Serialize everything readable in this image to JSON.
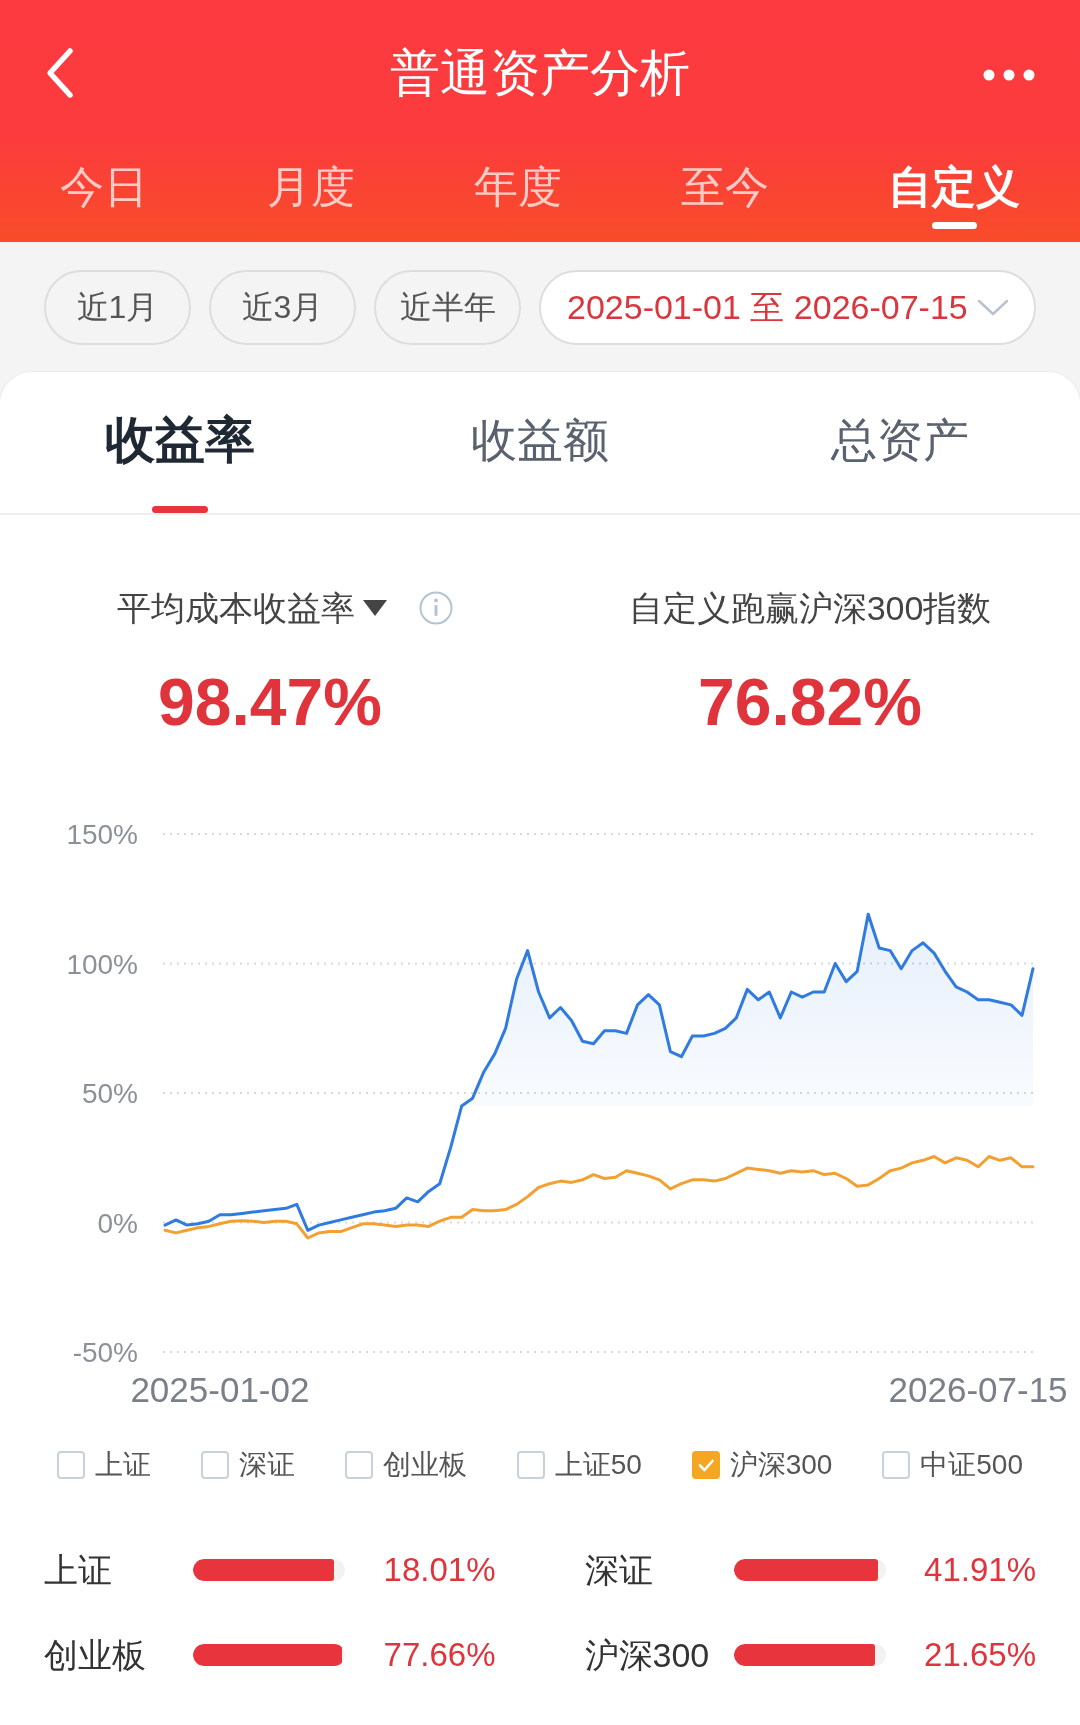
{
  "header": {
    "title": "普通资产分析"
  },
  "period_tabs": [
    {
      "label": "今日",
      "selected": false
    },
    {
      "label": "月度",
      "selected": false
    },
    {
      "label": "年度",
      "selected": false
    },
    {
      "label": "至今",
      "selected": false
    },
    {
      "label": "自定义",
      "selected": true
    }
  ],
  "range_chips": [
    {
      "kind": "preset",
      "label": "近1月",
      "selected": false
    },
    {
      "kind": "preset",
      "label": "近3月",
      "selected": false
    },
    {
      "kind": "preset",
      "label": "近半年",
      "selected": false
    },
    {
      "kind": "date",
      "label": "2025-01-01 至 2026-07-15",
      "selected": true
    }
  ],
  "metric_tabs": [
    {
      "label": "收益率",
      "selected": true
    },
    {
      "label": "收益额",
      "selected": false
    },
    {
      "label": "总资产",
      "selected": false
    }
  ],
  "stats": [
    {
      "kind": "dropdown",
      "label": "平均成本收益率",
      "value": "98.47%"
    },
    {
      "kind": "plain",
      "label": "自定义跑赢沪深300指数",
      "value": "76.82%"
    }
  ],
  "chart": {
    "chart_data": {
      "type": "line",
      "grid": true,
      "categories": [
        null,
        null,
        null,
        null,
        null,
        "2025-01-02",
        null,
        null,
        null,
        null,
        null,
        null,
        null,
        null,
        null,
        null,
        null,
        null,
        null,
        null,
        null,
        null,
        null,
        null,
        null,
        null,
        null,
        null,
        null,
        null,
        null,
        null,
        null,
        null,
        null,
        null,
        null,
        null,
        null,
        null,
        null,
        null,
        null,
        null,
        null,
        null,
        null,
        null,
        null,
        null,
        null,
        null,
        null,
        null,
        null,
        null,
        null,
        null,
        null,
        null,
        null,
        null,
        null,
        null,
        null,
        null,
        null,
        null,
        null,
        null,
        null,
        null,
        null,
        null,
        "2026-07-15",
        null,
        null,
        null,
        null,
        null
      ],
      "ylim": [
        -50,
        150
      ],
      "yticks": [
        {
          "value": 150,
          "label": "150%"
        },
        {
          "value": 100,
          "label": "100%"
        },
        {
          "value": 50,
          "label": "50%"
        },
        {
          "value": 0,
          "label": "0%"
        },
        {
          "value": -50,
          "label": "-50%"
        }
      ],
      "series": [
        {
          "color": "#2f7be0",
          "values": [
            -1,
            1,
            -1,
            -0.5,
            0.5,
            3,
            3,
            3.5,
            4,
            4.5,
            5,
            5.5,
            7,
            -3,
            -1,
            0,
            1,
            2,
            3,
            4,
            4.5,
            5.5,
            9.5,
            8,
            12,
            15,
            29,
            45,
            48,
            58,
            65,
            75,
            94,
            105,
            89,
            79,
            83,
            78,
            70,
            69,
            74,
            74,
            73,
            84,
            88,
            84,
            66,
            64,
            72,
            72,
            73,
            75,
            79,
            90,
            86,
            89,
            79,
            89,
            87,
            89,
            89,
            100,
            93,
            97,
            119,
            106,
            105,
            98,
            105,
            108,
            104,
            97,
            91,
            89,
            86,
            86,
            85,
            84,
            80,
            98
          ]
        },
        {
          "color": "#f2a032",
          "values": [
            -3,
            -4,
            -3,
            -2,
            -1.5,
            -0.5,
            0.5,
            0.7,
            0.5,
            0,
            0.5,
            0.5,
            -0.5,
            -6,
            -4,
            -3.5,
            -3.5,
            -2,
            -0.5,
            -0.5,
            -1,
            -1.5,
            -1,
            -1,
            -1.5,
            0.5,
            2,
            2,
            5,
            4.5,
            4.5,
            5,
            7,
            10,
            13.5,
            15,
            16,
            15.5,
            16.5,
            18.5,
            17,
            17.5,
            20,
            19,
            18,
            16.5,
            13,
            15,
            16.5,
            16.5,
            16,
            17,
            19,
            21,
            20.5,
            20,
            19,
            20,
            19.5,
            20,
            18.5,
            19,
            17,
            14,
            14.5,
            17,
            20,
            21,
            23,
            24,
            25.5,
            23,
            25,
            24,
            21.5,
            25.5,
            24,
            25,
            21.5,
            21.5
          ]
        }
      ]
    }
  },
  "index_toggles": [
    {
      "label": "上证",
      "checked": false
    },
    {
      "label": "深证",
      "checked": false
    },
    {
      "label": "创业板",
      "checked": false
    },
    {
      "label": "上证50",
      "checked": false
    },
    {
      "label": "沪深300",
      "checked": true
    },
    {
      "label": "中证500",
      "checked": false
    }
  ],
  "index_returns": [
    {
      "name": "上证",
      "level": 0.93,
      "value": "18.01%"
    },
    {
      "name": "深证",
      "level": 0.95,
      "value": "41.91%"
    },
    {
      "name": "创业板",
      "level": 0.98,
      "value": "77.66%"
    },
    {
      "name": "沪深300",
      "level": 0.93,
      "value": "21.65%"
    }
  ]
}
